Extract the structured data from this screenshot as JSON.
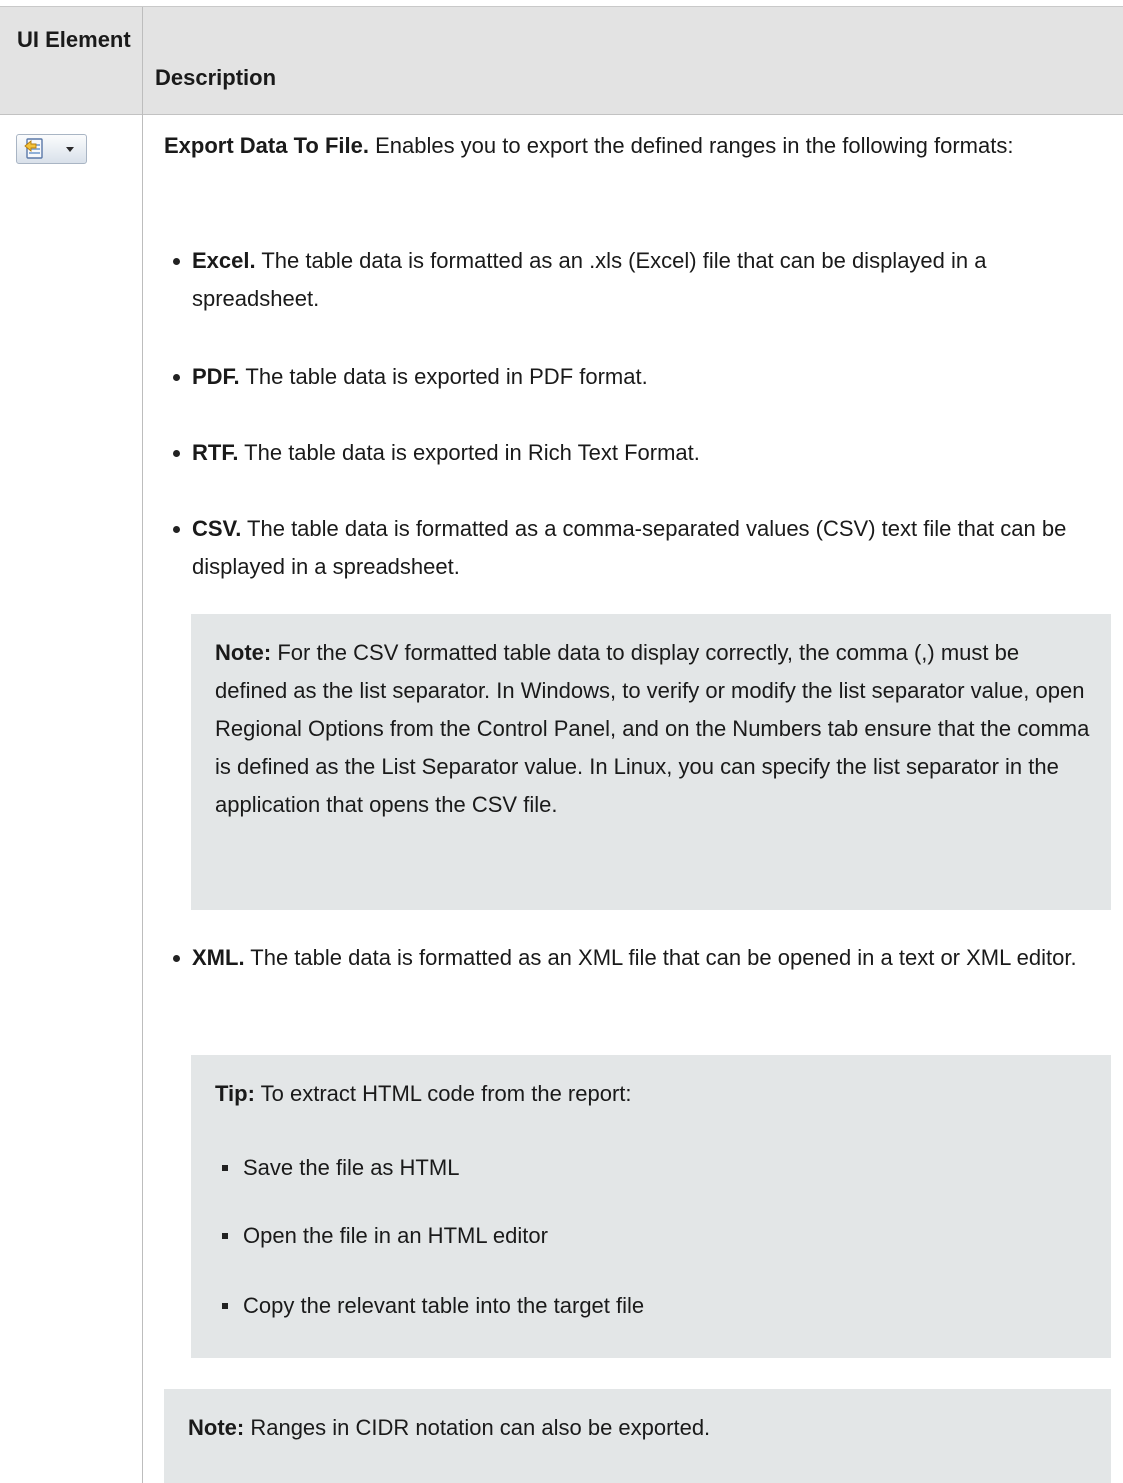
{
  "header": {
    "col1": "UI Element",
    "col2": "Description"
  },
  "icon": {
    "name": "export-data-icon"
  },
  "description": {
    "title": "Export Data To File.",
    "intro": " Enables you to export the defined ranges in the following formats:",
    "formats": [
      {
        "name": "Excel.",
        "text": " The table data is formatted as an .xls (Excel) file that can be displayed in a spreadsheet."
      },
      {
        "name": "PDF.",
        "text": " The table data is exported in PDF format."
      },
      {
        "name": "RTF.",
        "text": " The table data is exported in Rich Text Format."
      },
      {
        "name": "CSV.",
        "text": " The table data is formatted as a comma-separated values (CSV) text file that can be displayed in a spreadsheet."
      },
      {
        "name": "XML.",
        "text": " The table data is formatted as an XML file that can be opened in a text or XML editor."
      }
    ],
    "csv_note": {
      "label": "Note:",
      "text": " For the CSV formatted table data to display correctly, the comma (,) must be defined as the list separator. In Windows, to verify or modify the list separator value, open Regional Options from the Control Panel, and on the Numbers tab ensure that the comma is defined as the List Separator value. In Linux, you can specify the list separator in the application that opens the CSV file."
    },
    "tip": {
      "label": "Tip:",
      "text": " To extract HTML code from the report:",
      "steps": [
        "Save the file as HTML",
        "Open the file in an HTML editor",
        "Copy the relevant table into the target file"
      ]
    },
    "cidr_note": {
      "label": "Note:",
      "text": " Ranges in CIDR notation can also be exported."
    }
  }
}
